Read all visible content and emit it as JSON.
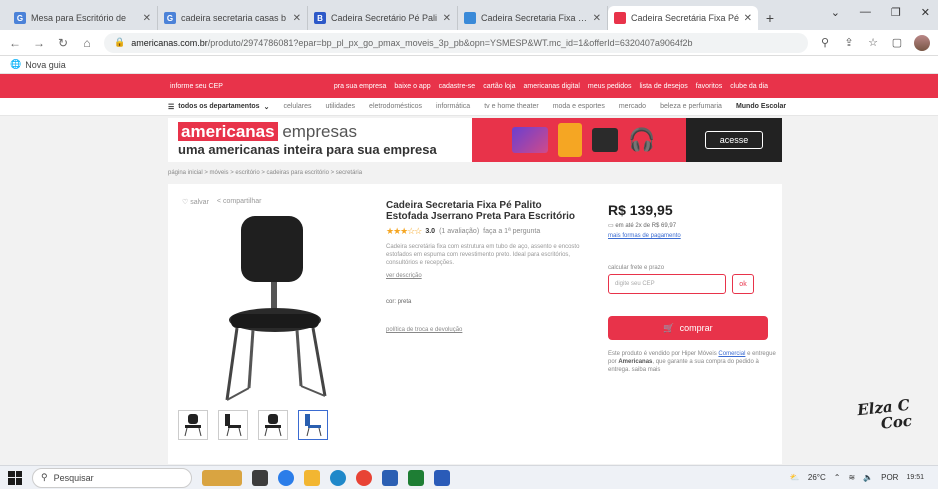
{
  "browser": {
    "tabs": [
      {
        "label": "Mesa para Escritório de",
        "favicon_color": "#4b82d8",
        "favicon_text": "G"
      },
      {
        "label": "cadeira secretaria casas b",
        "favicon_color": "#4b82d8",
        "favicon_text": "G"
      },
      {
        "label": "Cadeira Secretário Pé Pali",
        "favicon_color": "#2d59c8",
        "favicon_text": "B"
      },
      {
        "label": "Cadeira Secretaria Fixa Pé",
        "favicon_color": "#3a8ad8",
        "favicon_text": ""
      },
      {
        "label": "Cadeira Secretária Fixa Pé",
        "favicon_color": "#e8334a",
        "favicon_text": "",
        "active": true
      }
    ],
    "new_tab": "+",
    "url_domain": "americanas.com.br",
    "url_path": "/produto/2974786081?epar=bp_pl_px_go_pmax_moveis_3p_pb&opn=YSMESP&WT.mc_id=1&offerId=6320407a9064f2b",
    "bookmark": "Nova guia"
  },
  "site": {
    "top_links": [
      "informe seu CEP",
      "pra sua empresa",
      "baixe o app",
      "cadastre-se",
      "cartão loja",
      "americanas digital",
      "meus pedidos",
      "lista de desejos",
      "favoritos",
      "clube da dia"
    ],
    "menu_label": "todos os departamentos",
    "categories": [
      "celulares",
      "utilidades",
      "eletrodomésticos",
      "informática",
      "tv e home theater",
      "moda e esportes",
      "mercado",
      "beleza e perfumaria",
      "Mundo Escolar"
    ],
    "banner": {
      "brand": "americanas",
      "brand_suffix": "empresas",
      "tagline": "uma americanas inteira para sua empresa",
      "cta": "acesse"
    },
    "breadcrumb": "página inicial > móveis > escritório > cadeiras para escritório > secretária"
  },
  "product": {
    "actions": [
      "salvar",
      "compartilhar"
    ],
    "title": "Cadeira Secretaria Fixa Pé Palito Estofada Jserrano Preta Para Escritório",
    "stars": "★★★☆☆",
    "rating": "3.0",
    "reviews": "(1 avaliação)",
    "questions": "faça a 1ª pergunta",
    "description": "Cadeira secretária fixa com estrutura em tubo de aço, assento e encosto estofados em espuma com revestimento preto. Ideal para escritórios, consultórios e recepções.",
    "description_link": "ver descrição",
    "color": "cor: preta",
    "policy_link": "política de troca e devolução",
    "price": "R$ 139,95",
    "installment": "em até 2x de R$ 69,97",
    "payment_link": "mais formas de pagamento",
    "cep_label": "calcular frete e prazo",
    "cep_placeholder": "digite seu CEP",
    "cep_ok": "ok",
    "buy_label": "comprar",
    "seller_text_1": "Este produto é vendido por Hiper Móveis",
    "seller_link": "Comercial",
    "seller_text_2": "e entregue por",
    "seller_store": "Americanas",
    "seller_text_3": "que garante a sua compra do pedido à entrega. saiba mais"
  },
  "signature": {
    "line1": "Elza C",
    "line2": "Coc"
  },
  "taskbar": {
    "search_label": "Pesquisar",
    "weather": "26°C",
    "language": "POR",
    "time": "19:51"
  }
}
